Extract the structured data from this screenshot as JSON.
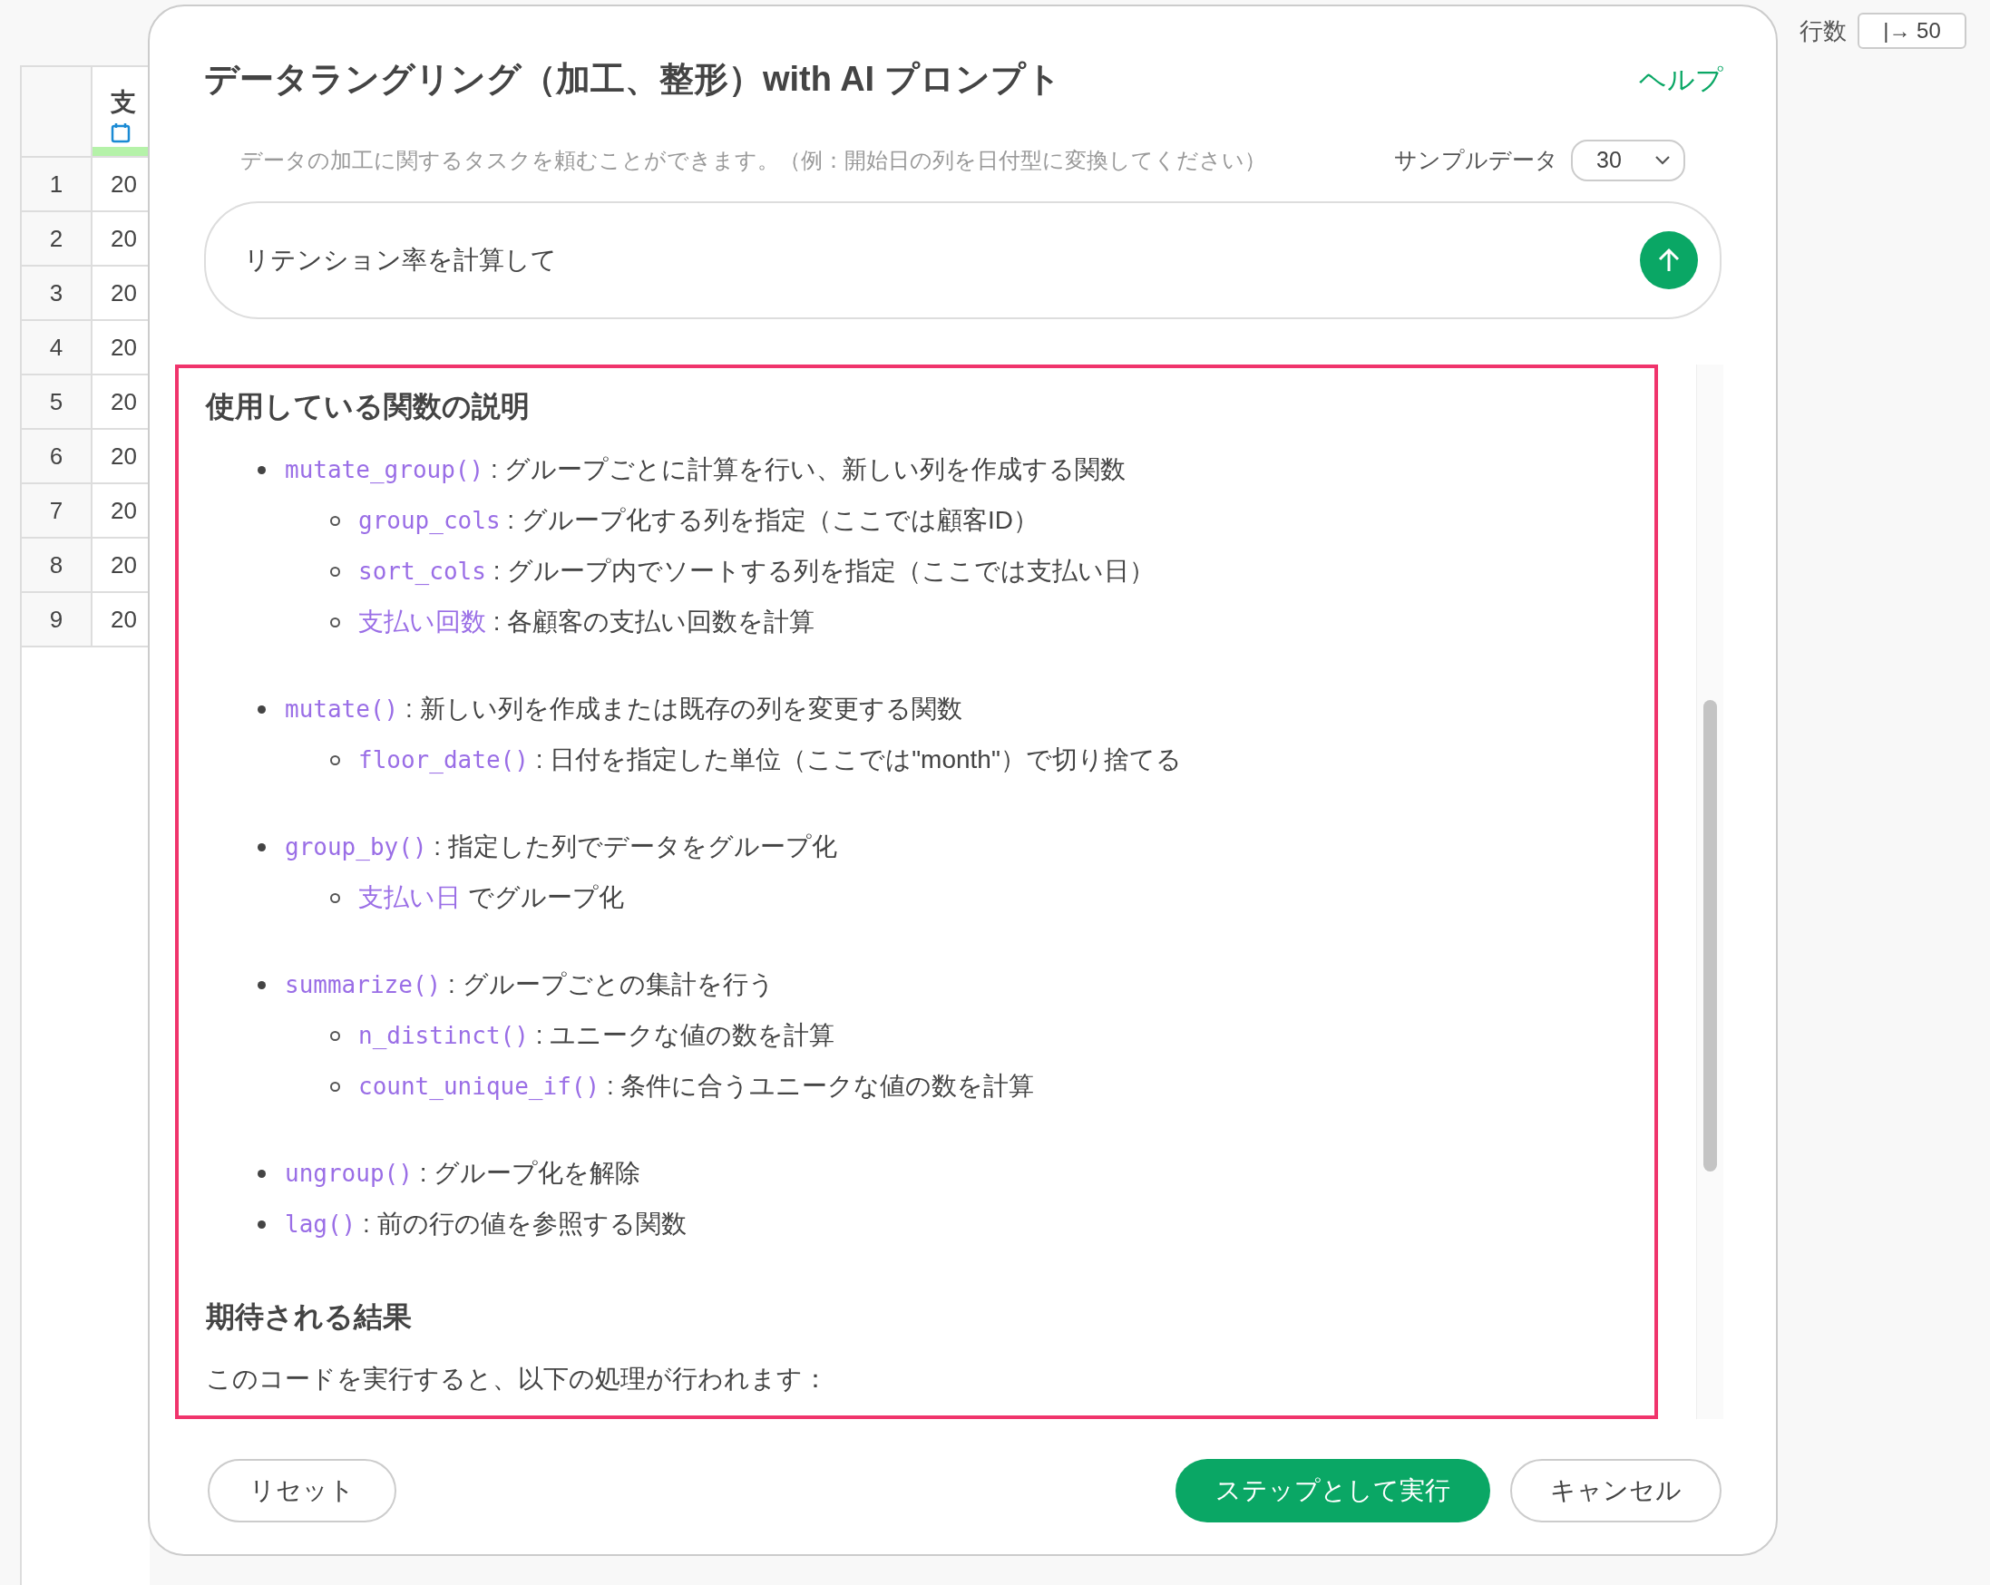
{
  "background_table": {
    "row_count_label": "行数",
    "row_count_value": "|→ 50",
    "column_header": "支",
    "rows": [
      {
        "number": "1",
        "value": "20"
      },
      {
        "number": "2",
        "value": "20"
      },
      {
        "number": "3",
        "value": "20"
      },
      {
        "number": "4",
        "value": "20"
      },
      {
        "number": "5",
        "value": "20"
      },
      {
        "number": "6",
        "value": "20"
      },
      {
        "number": "7",
        "value": "20"
      },
      {
        "number": "8",
        "value": "20"
      },
      {
        "number": "9",
        "value": "20"
      }
    ]
  },
  "dialog": {
    "title": "データラングリング（加工、整形）with AI プロンプト",
    "help_link": "ヘルプ",
    "hint": "データの加工に関するタスクを頼むことができます。（例：開始日の列を日付型に変換してください）",
    "sample_label": "サンプルデータ",
    "sample_value": "30",
    "prompt": "リテンション率を計算して",
    "response": {
      "heading": "使用している関数の説明",
      "groups": [
        [
          {
            "term": "mutate_group()",
            "kind": "code",
            "text": ": グループごとに計算を行い、新しい列を作成する関数",
            "children": [
              {
                "term": "group_cols",
                "kind": "code",
                "text": ": グループ化する列を指定（ここでは顧客ID）"
              },
              {
                "term": "sort_cols",
                "kind": "code",
                "text": ": グループ内でソートする列を指定（ここでは支払い日）"
              },
              {
                "term": "支払い回数",
                "kind": "name",
                "text": ": 各顧客の支払い回数を計算"
              }
            ]
          }
        ],
        [
          {
            "term": "mutate()",
            "kind": "code",
            "text": ": 新しい列を作成または既存の列を変更する関数",
            "children": [
              {
                "term": "floor_date()",
                "kind": "code",
                "text": ": 日付を指定した単位（ここでは\"month\"）で切り捨てる"
              }
            ]
          }
        ],
        [
          {
            "term": "group_by()",
            "kind": "code",
            "text": ": 指定した列でデータをグループ化",
            "children": [
              {
                "term": "支払い日",
                "kind": "name",
                "text": "でグループ化"
              }
            ]
          }
        ],
        [
          {
            "term": "summarize()",
            "kind": "code",
            "text": ": グループごとの集計を行う",
            "children": [
              {
                "term": "n_distinct()",
                "kind": "code",
                "text": ": ユニークな値の数を計算"
              },
              {
                "term": "count_unique_if()",
                "kind": "code",
                "text": ": 条件に合うユニークな値の数を計算"
              }
            ]
          }
        ],
        [
          {
            "term": "ungroup()",
            "kind": "code",
            "text": ": グループ化を解除"
          },
          {
            "term": "lag()",
            "kind": "code",
            "text": ": 前の行の値を参照する関数"
          }
        ]
      ],
      "heading_2": "期待される結果",
      "paragraph": "このコードを実行すると、以下の処理が行われます："
    },
    "buttons": {
      "reset": "リセット",
      "run": "ステップとして実行",
      "cancel": "キャンセル"
    }
  }
}
